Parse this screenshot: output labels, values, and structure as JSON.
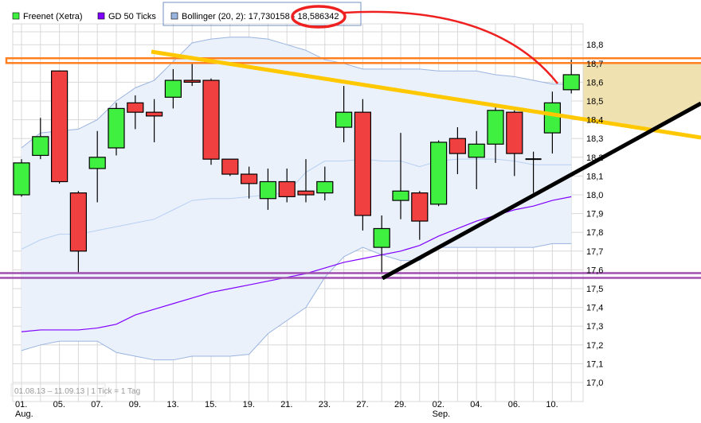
{
  "chart_data": {
    "type": "candlestick",
    "legend": [
      {
        "label": "Freenet (Xetra)",
        "color": "#40f040"
      },
      {
        "label": "GD 50 Ticks",
        "color": "#8000ff"
      },
      {
        "label": "Bollinger (20, 2): 17,730158 - 18,586342",
        "color": "#9ab4e0"
      }
    ],
    "legend_placement": "top-left",
    "range_text": "01.08.13 – 11.09.13 | 1 Tick = 1 Tag",
    "ylim": [
      16.95,
      18.9
    ],
    "yticks": [
      "17,0",
      "17,1",
      "17,2",
      "17,3",
      "17,4",
      "17,5",
      "17,6",
      "17,7",
      "17,8",
      "17,9",
      "18,0",
      "18,1",
      "18,2",
      "18,3",
      "18,4",
      "18,5",
      "18,6",
      "18,7",
      "18,8"
    ],
    "xticks": [
      {
        "index": 0,
        "label": "01.",
        "sub": "Aug."
      },
      {
        "index": 2,
        "label": "05."
      },
      {
        "index": 4,
        "label": "07."
      },
      {
        "index": 6,
        "label": "09."
      },
      {
        "index": 8,
        "label": "13."
      },
      {
        "index": 10,
        "label": "15."
      },
      {
        "index": 12,
        "label": "19."
      },
      {
        "index": 14,
        "label": "21."
      },
      {
        "index": 16,
        "label": "23."
      },
      {
        "index": 18,
        "label": "27."
      },
      {
        "index": 20,
        "label": "29."
      },
      {
        "index": 22,
        "label": "02.",
        "sub": "Sep."
      },
      {
        "index": 24,
        "label": "04."
      },
      {
        "index": 26,
        "label": "06."
      },
      {
        "index": 28,
        "label": "10."
      }
    ],
    "ohlc": [
      [
        18.0,
        18.19,
        17.99,
        18.17
      ],
      [
        18.21,
        18.41,
        18.19,
        18.31
      ],
      [
        18.66,
        18.66,
        18.06,
        18.07
      ],
      [
        18.01,
        18.02,
        17.58,
        17.7
      ],
      [
        18.14,
        18.34,
        17.96,
        18.2
      ],
      [
        18.25,
        18.49,
        18.21,
        18.46
      ],
      [
        18.49,
        18.53,
        18.35,
        18.44
      ],
      [
        18.44,
        18.51,
        18.28,
        18.42
      ],
      [
        18.52,
        18.67,
        18.46,
        18.61
      ],
      [
        18.61,
        18.7,
        18.58,
        18.6
      ],
      [
        18.61,
        18.62,
        18.16,
        18.19
      ],
      [
        18.19,
        18.19,
        18.1,
        18.11
      ],
      [
        18.11,
        18.15,
        17.98,
        18.06
      ],
      [
        17.98,
        18.14,
        17.92,
        18.07
      ],
      [
        18.07,
        18.14,
        17.96,
        17.99
      ],
      [
        18.02,
        18.19,
        17.96,
        18.0
      ],
      [
        18.01,
        18.15,
        17.97,
        18.07
      ],
      [
        18.36,
        18.58,
        18.28,
        18.44
      ],
      [
        18.44,
        18.51,
        17.81,
        17.89
      ],
      [
        17.72,
        17.89,
        17.58,
        17.82
      ],
      [
        17.97,
        18.33,
        17.87,
        18.02
      ],
      [
        18.01,
        18.02,
        17.76,
        17.86
      ],
      [
        17.95,
        18.29,
        17.94,
        18.28
      ],
      [
        18.3,
        18.36,
        18.11,
        18.22
      ],
      [
        18.2,
        18.34,
        18.03,
        18.27
      ],
      [
        18.27,
        18.47,
        18.17,
        18.45
      ],
      [
        18.44,
        18.45,
        18.1,
        18.22
      ],
      [
        18.19,
        18.23,
        18.01,
        18.19
      ],
      [
        18.33,
        18.55,
        18.22,
        18.49
      ],
      [
        18.56,
        18.72,
        18.54,
        18.64
      ]
    ],
    "bollinger_upper": [
      18.25,
      18.33,
      18.34,
      18.35,
      18.4,
      18.5,
      18.57,
      18.61,
      18.71,
      18.81,
      18.83,
      18.84,
      18.84,
      18.83,
      18.8,
      18.77,
      18.72,
      18.7,
      18.67,
      18.67,
      18.67,
      18.67,
      18.66,
      18.66,
      18.66,
      18.64,
      18.63,
      18.61,
      18.59,
      18.59
    ],
    "bollinger_middle": [
      17.71,
      17.76,
      17.79,
      17.79,
      17.81,
      17.83,
      17.85,
      17.87,
      17.92,
      17.97,
      17.98,
      17.98,
      17.99,
      18.0,
      18.01,
      18.12,
      18.18,
      18.18,
      18.19,
      18.18,
      18.18,
      18.15,
      18.18,
      18.19,
      18.19,
      18.19,
      18.18,
      18.16,
      18.16,
      18.16
    ],
    "bollinger_lower": [
      17.17,
      17.2,
      17.22,
      17.22,
      17.22,
      17.16,
      17.14,
      17.12,
      17.12,
      17.14,
      17.14,
      17.14,
      17.15,
      17.26,
      17.33,
      17.4,
      17.56,
      17.67,
      17.72,
      17.68,
      17.65,
      17.65,
      17.72,
      17.72,
      17.72,
      17.72,
      17.72,
      17.72,
      17.74,
      17.74
    ],
    "gd50": [
      17.27,
      17.28,
      17.28,
      17.28,
      17.29,
      17.31,
      17.36,
      17.39,
      17.42,
      17.45,
      17.48,
      17.5,
      17.52,
      17.54,
      17.56,
      17.58,
      17.61,
      17.64,
      17.66,
      17.68,
      17.7,
      17.73,
      17.78,
      17.82,
      17.86,
      17.89,
      17.92,
      17.94,
      17.97,
      17.99
    ],
    "annotations": {
      "resistance_price": 18.715,
      "support_price": 17.57,
      "colors": {
        "resistance": "#ff8020",
        "support": "#a050b0",
        "downtrend": "#ffc800",
        "uptrend": "#000000",
        "highlight": "#ee2020",
        "zone": "#efe2b0"
      }
    },
    "colors": {
      "up": "#40f040",
      "down": "#f04040",
      "band_fill": "#eaf1fb",
      "band_line": "#9ab4e0",
      "middle_line": "#b8d0f4",
      "gd50": "#8000ff",
      "grid": "#d8d8d8"
    }
  }
}
